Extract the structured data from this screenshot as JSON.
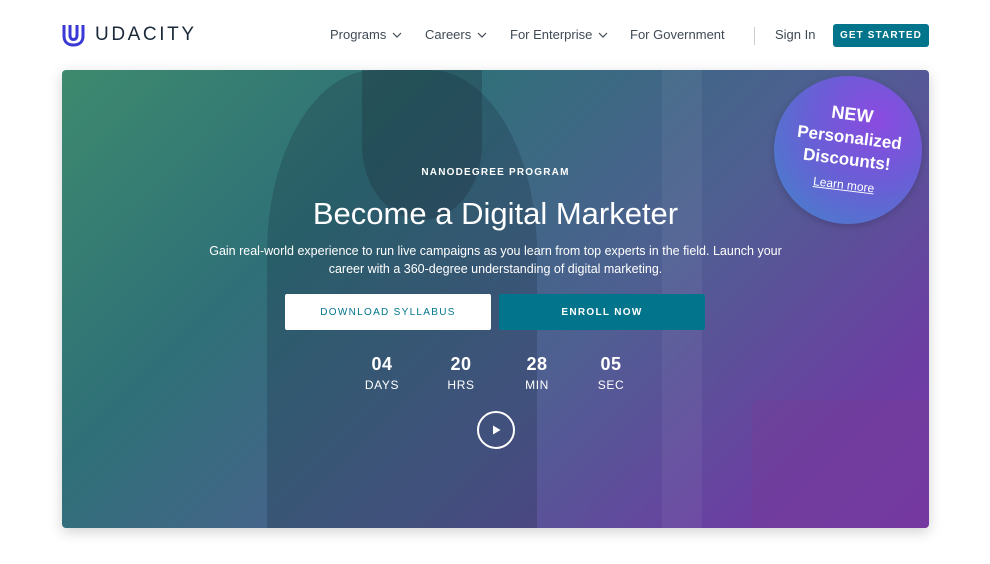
{
  "header": {
    "brand": "UDACITY",
    "nav": [
      {
        "label": "Programs",
        "dropdown": true
      },
      {
        "label": "Careers",
        "dropdown": true
      },
      {
        "label": "For Enterprise",
        "dropdown": true
      },
      {
        "label": "For Government",
        "dropdown": false
      }
    ],
    "sign_in": "Sign In",
    "cta": "GET STARTED"
  },
  "hero": {
    "eyebrow": "NANODEGREE PROGRAM",
    "title": "Become a Digital Marketer",
    "subtitle": "Gain real-world experience to run live campaigns as you learn from top experts in the field. Launch your career with a 360-degree understanding of digital marketing.",
    "download_label": "DOWNLOAD SYLLABUS",
    "enroll_label": "ENROLL NOW",
    "countdown": [
      {
        "value": "04",
        "unit": "DAYS"
      },
      {
        "value": "20",
        "unit": "HRS"
      },
      {
        "value": "28",
        "unit": "MIN"
      },
      {
        "value": "05",
        "unit": "SEC"
      }
    ]
  },
  "badge": {
    "line1": "NEW",
    "line2": "Personalized",
    "line3": "Discounts!",
    "link": "Learn more"
  },
  "colors": {
    "brand_blue": "#3a39d6",
    "accent_teal": "#02758d",
    "badge_purple": "#8a4be0"
  },
  "icons": {
    "logo": "udacity-logo-icon",
    "dropdown": "chevron-down-icon",
    "video": "play-icon"
  }
}
